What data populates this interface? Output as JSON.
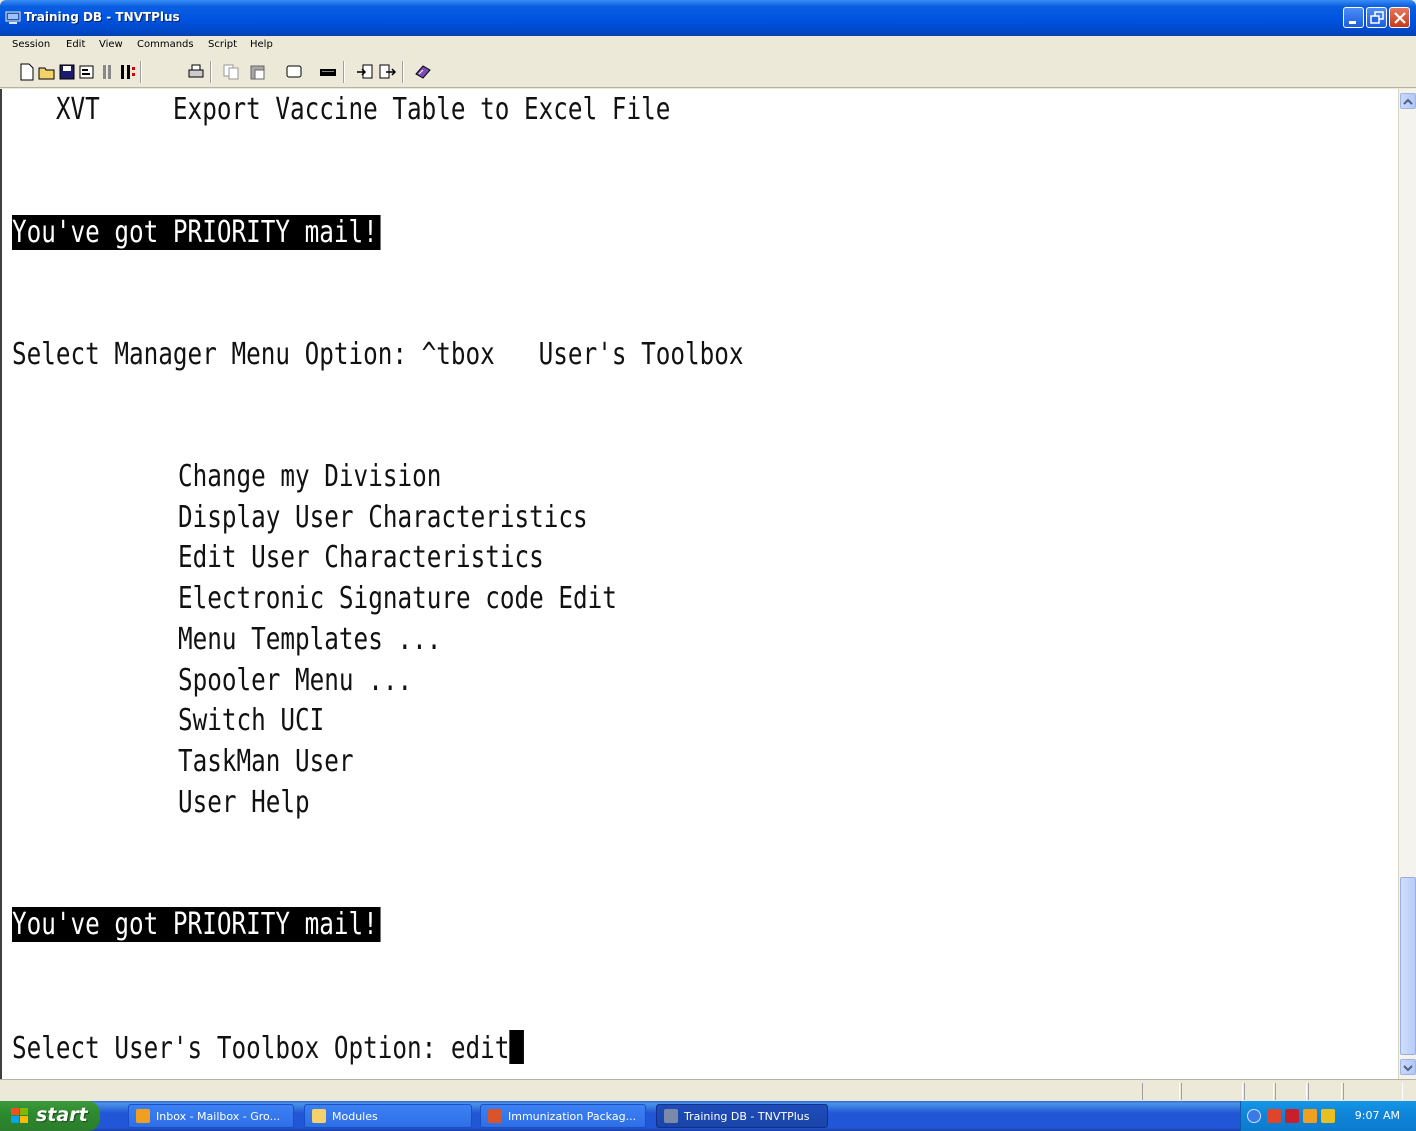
{
  "window": {
    "title": "Training DB - TNVTPlus"
  },
  "menu": [
    "Session",
    "Edit",
    "View",
    "Commands",
    "Script",
    "Help"
  ],
  "terminal": {
    "line_xvt": "   XVT     Export Vaccine Table to Excel File",
    "priority_mail": "You've got PRIORITY mail!",
    "manager_prompt": "Select Manager Menu Option: ^tbox   User's Toolbox",
    "options": [
      "Change my Division",
      "Display User Characteristics",
      "Edit User Characteristics",
      "Electronic Signature code Edit",
      "Menu Templates ...",
      "Spooler Menu ...",
      "Switch UCI",
      "TaskMan User",
      "User Help"
    ],
    "priority_mail_2": "You've got PRIORITY mail!",
    "toolbox_prompt": "Select User's Toolbox Option: edit"
  },
  "taskbar": {
    "start_label": "start",
    "tasks": [
      {
        "label": "Inbox - Mailbox - Gro...",
        "color": "#f0a020"
      },
      {
        "label": "Modules",
        "color": "#f5d26b"
      },
      {
        "label": "Immunization Packag...",
        "color": "#d9542a"
      },
      {
        "label": "Training DB - TNVTPlus",
        "color": "#7a8aa8"
      }
    ],
    "clock": "9:07 AM"
  }
}
